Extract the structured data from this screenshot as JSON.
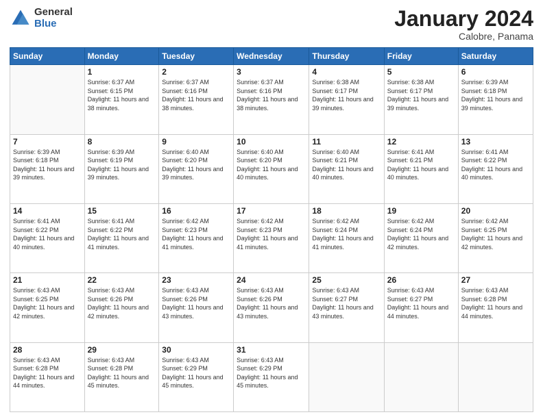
{
  "header": {
    "logo": {
      "general": "General",
      "blue": "Blue"
    },
    "title": "January 2024",
    "location": "Calobre, Panama"
  },
  "weekdays": [
    "Sunday",
    "Monday",
    "Tuesday",
    "Wednesday",
    "Thursday",
    "Friday",
    "Saturday"
  ],
  "weeks": [
    [
      {
        "day": "",
        "sunrise": "",
        "sunset": "",
        "daylight": ""
      },
      {
        "day": "1",
        "sunrise": "Sunrise: 6:37 AM",
        "sunset": "Sunset: 6:15 PM",
        "daylight": "Daylight: 11 hours and 38 minutes."
      },
      {
        "day": "2",
        "sunrise": "Sunrise: 6:37 AM",
        "sunset": "Sunset: 6:16 PM",
        "daylight": "Daylight: 11 hours and 38 minutes."
      },
      {
        "day": "3",
        "sunrise": "Sunrise: 6:37 AM",
        "sunset": "Sunset: 6:16 PM",
        "daylight": "Daylight: 11 hours and 38 minutes."
      },
      {
        "day": "4",
        "sunrise": "Sunrise: 6:38 AM",
        "sunset": "Sunset: 6:17 PM",
        "daylight": "Daylight: 11 hours and 39 minutes."
      },
      {
        "day": "5",
        "sunrise": "Sunrise: 6:38 AM",
        "sunset": "Sunset: 6:17 PM",
        "daylight": "Daylight: 11 hours and 39 minutes."
      },
      {
        "day": "6",
        "sunrise": "Sunrise: 6:39 AM",
        "sunset": "Sunset: 6:18 PM",
        "daylight": "Daylight: 11 hours and 39 minutes."
      }
    ],
    [
      {
        "day": "7",
        "sunrise": "Sunrise: 6:39 AM",
        "sunset": "Sunset: 6:18 PM",
        "daylight": "Daylight: 11 hours and 39 minutes."
      },
      {
        "day": "8",
        "sunrise": "Sunrise: 6:39 AM",
        "sunset": "Sunset: 6:19 PM",
        "daylight": "Daylight: 11 hours and 39 minutes."
      },
      {
        "day": "9",
        "sunrise": "Sunrise: 6:40 AM",
        "sunset": "Sunset: 6:20 PM",
        "daylight": "Daylight: 11 hours and 39 minutes."
      },
      {
        "day": "10",
        "sunrise": "Sunrise: 6:40 AM",
        "sunset": "Sunset: 6:20 PM",
        "daylight": "Daylight: 11 hours and 40 minutes."
      },
      {
        "day": "11",
        "sunrise": "Sunrise: 6:40 AM",
        "sunset": "Sunset: 6:21 PM",
        "daylight": "Daylight: 11 hours and 40 minutes."
      },
      {
        "day": "12",
        "sunrise": "Sunrise: 6:41 AM",
        "sunset": "Sunset: 6:21 PM",
        "daylight": "Daylight: 11 hours and 40 minutes."
      },
      {
        "day": "13",
        "sunrise": "Sunrise: 6:41 AM",
        "sunset": "Sunset: 6:22 PM",
        "daylight": "Daylight: 11 hours and 40 minutes."
      }
    ],
    [
      {
        "day": "14",
        "sunrise": "Sunrise: 6:41 AM",
        "sunset": "Sunset: 6:22 PM",
        "daylight": "Daylight: 11 hours and 40 minutes."
      },
      {
        "day": "15",
        "sunrise": "Sunrise: 6:41 AM",
        "sunset": "Sunset: 6:22 PM",
        "daylight": "Daylight: 11 hours and 41 minutes."
      },
      {
        "day": "16",
        "sunrise": "Sunrise: 6:42 AM",
        "sunset": "Sunset: 6:23 PM",
        "daylight": "Daylight: 11 hours and 41 minutes."
      },
      {
        "day": "17",
        "sunrise": "Sunrise: 6:42 AM",
        "sunset": "Sunset: 6:23 PM",
        "daylight": "Daylight: 11 hours and 41 minutes."
      },
      {
        "day": "18",
        "sunrise": "Sunrise: 6:42 AM",
        "sunset": "Sunset: 6:24 PM",
        "daylight": "Daylight: 11 hours and 41 minutes."
      },
      {
        "day": "19",
        "sunrise": "Sunrise: 6:42 AM",
        "sunset": "Sunset: 6:24 PM",
        "daylight": "Daylight: 11 hours and 42 minutes."
      },
      {
        "day": "20",
        "sunrise": "Sunrise: 6:42 AM",
        "sunset": "Sunset: 6:25 PM",
        "daylight": "Daylight: 11 hours and 42 minutes."
      }
    ],
    [
      {
        "day": "21",
        "sunrise": "Sunrise: 6:43 AM",
        "sunset": "Sunset: 6:25 PM",
        "daylight": "Daylight: 11 hours and 42 minutes."
      },
      {
        "day": "22",
        "sunrise": "Sunrise: 6:43 AM",
        "sunset": "Sunset: 6:26 PM",
        "daylight": "Daylight: 11 hours and 42 minutes."
      },
      {
        "day": "23",
        "sunrise": "Sunrise: 6:43 AM",
        "sunset": "Sunset: 6:26 PM",
        "daylight": "Daylight: 11 hours and 43 minutes."
      },
      {
        "day": "24",
        "sunrise": "Sunrise: 6:43 AM",
        "sunset": "Sunset: 6:26 PM",
        "daylight": "Daylight: 11 hours and 43 minutes."
      },
      {
        "day": "25",
        "sunrise": "Sunrise: 6:43 AM",
        "sunset": "Sunset: 6:27 PM",
        "daylight": "Daylight: 11 hours and 43 minutes."
      },
      {
        "day": "26",
        "sunrise": "Sunrise: 6:43 AM",
        "sunset": "Sunset: 6:27 PM",
        "daylight": "Daylight: 11 hours and 44 minutes."
      },
      {
        "day": "27",
        "sunrise": "Sunrise: 6:43 AM",
        "sunset": "Sunset: 6:28 PM",
        "daylight": "Daylight: 11 hours and 44 minutes."
      }
    ],
    [
      {
        "day": "28",
        "sunrise": "Sunrise: 6:43 AM",
        "sunset": "Sunset: 6:28 PM",
        "daylight": "Daylight: 11 hours and 44 minutes."
      },
      {
        "day": "29",
        "sunrise": "Sunrise: 6:43 AM",
        "sunset": "Sunset: 6:28 PM",
        "daylight": "Daylight: 11 hours and 45 minutes."
      },
      {
        "day": "30",
        "sunrise": "Sunrise: 6:43 AM",
        "sunset": "Sunset: 6:29 PM",
        "daylight": "Daylight: 11 hours and 45 minutes."
      },
      {
        "day": "31",
        "sunrise": "Sunrise: 6:43 AM",
        "sunset": "Sunset: 6:29 PM",
        "daylight": "Daylight: 11 hours and 45 minutes."
      },
      {
        "day": "",
        "sunrise": "",
        "sunset": "",
        "daylight": ""
      },
      {
        "day": "",
        "sunrise": "",
        "sunset": "",
        "daylight": ""
      },
      {
        "day": "",
        "sunrise": "",
        "sunset": "",
        "daylight": ""
      }
    ]
  ]
}
